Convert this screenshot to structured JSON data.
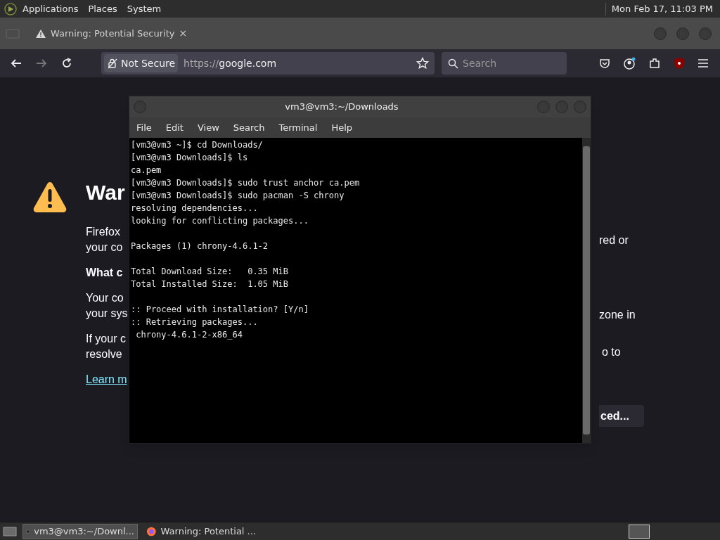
{
  "top_panel": {
    "menus": [
      "Applications",
      "Places",
      "System"
    ],
    "clock": "Mon Feb 17, 11:03 PM"
  },
  "browser": {
    "tab": {
      "title": "Warning: Potential Security",
      "close": "×"
    },
    "address_bar": {
      "security": "Not Secure",
      "url_prefix": "https://",
      "url_host": "google.com"
    },
    "search": {
      "placeholder": "Search"
    },
    "page": {
      "heading": "War",
      "left_fragments": [
        {
          "kind": "text",
          "lines": [
            "Firefox",
            "your co"
          ]
        },
        {
          "kind": "bold",
          "lines": [
            "What c"
          ]
        },
        {
          "kind": "text",
          "lines": [
            "Your co",
            "your sys"
          ]
        },
        {
          "kind": "text",
          "lines": [
            "If your c",
            "resolve"
          ]
        },
        {
          "kind": "link",
          "lines": [
            "Learn m"
          ]
        }
      ],
      "right_fragments": [
        "red or",
        "zone in",
        "o to"
      ],
      "button": "ced..."
    }
  },
  "terminal": {
    "title": "vm3@vm3:~/Downloads",
    "menu": [
      "File",
      "Edit",
      "View",
      "Search",
      "Terminal",
      "Help"
    ],
    "blocks": [
      [
        "[vm3@vm3 ~]$ cd Downloads/",
        "[vm3@vm3 Downloads]$ ls",
        "ca.pem",
        "[vm3@vm3 Downloads]$ sudo trust anchor ca.pem",
        "[vm3@vm3 Downloads]$ sudo pacman -S chrony",
        "resolving dependencies...",
        "looking for conflicting packages..."
      ],
      [
        "Packages (1) chrony-4.6.1-2"
      ],
      [
        "Total Download Size:   0.35 MiB",
        "Total Installed Size:  1.05 MiB"
      ],
      [
        ":: Proceed with installation? [Y/n]",
        ":: Retrieving packages...",
        " chrony-4.6.1-2-x86_64"
      ]
    ]
  },
  "taskbar": {
    "items": [
      {
        "label": "vm3@vm3:~/Downl...",
        "kind": "terminal",
        "selected": true
      },
      {
        "label": "Warning: Potential ...",
        "kind": "browser",
        "selected": false
      }
    ]
  }
}
